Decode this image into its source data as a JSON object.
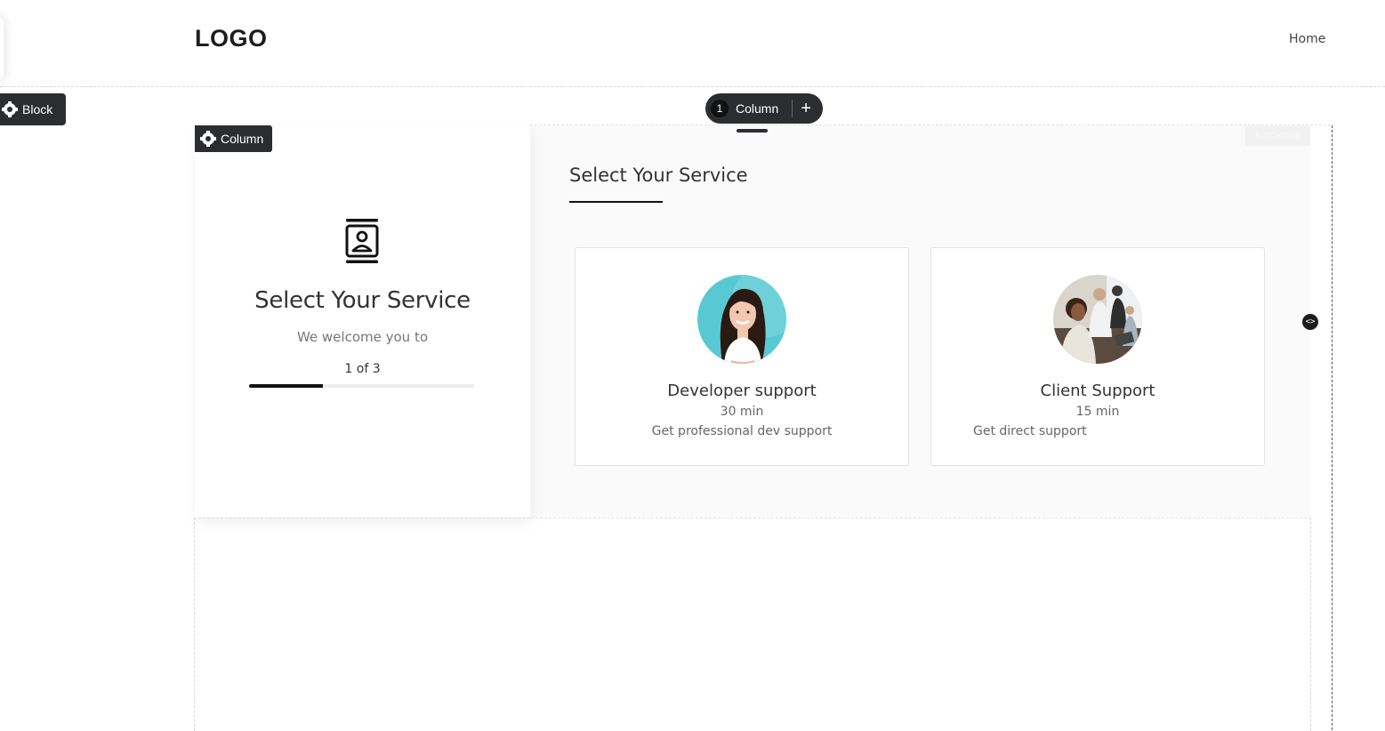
{
  "header": {
    "logo": "LOGO",
    "nav": [
      {
        "label": "Home"
      }
    ]
  },
  "editor": {
    "block_chip": "Block",
    "column_chip": "Column",
    "column_pill": {
      "count": "1",
      "label": "Column",
      "add": "+"
    },
    "section_tag": "BOOKING",
    "resize_handle": "<>"
  },
  "intro": {
    "icon": "contact-card-icon",
    "title": "Select Your Service",
    "subtitle": "We welcome you to",
    "step": "1 of 3",
    "progress": 0.33
  },
  "services": {
    "title": "Select Your Service",
    "items": [
      {
        "name": "Developer support",
        "duration": "30 min",
        "description": "Get professional dev support",
        "avatar": "woman-portrait-avatar"
      },
      {
        "name": "Client Support",
        "duration": "15 min",
        "description": "Get direct support",
        "avatar": "team-meeting-avatar"
      }
    ]
  },
  "colors": {
    "accent": "#111111",
    "chip_bg": "#2b2d31",
    "section_bg": "#fafafa",
    "avatar_teal": "#4fc3cf"
  }
}
